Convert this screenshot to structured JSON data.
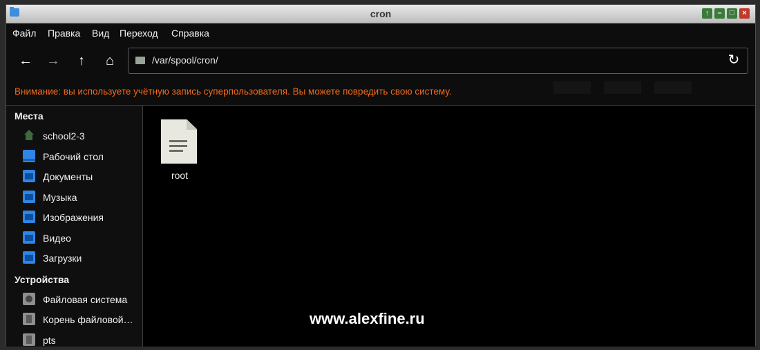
{
  "window": {
    "title": "cron"
  },
  "menu": [
    "Файл",
    "Правка",
    "Вид",
    "Переход",
    "Справка"
  ],
  "toolbar": {
    "path": "/var/spool/cron/"
  },
  "warning": "Внимание: вы используете учётную запись суперпользователя. Вы можете повредить свою систему.",
  "sidebar": {
    "places_title": "Места",
    "places": [
      {
        "label": "school2-3",
        "icon": "home-icon"
      },
      {
        "label": "Рабочий стол",
        "icon": "desktop-folder-icon"
      },
      {
        "label": "Документы",
        "icon": "documents-folder-icon"
      },
      {
        "label": "Музыка",
        "icon": "music-folder-icon"
      },
      {
        "label": "Изображения",
        "icon": "pictures-folder-icon"
      },
      {
        "label": "Видео",
        "icon": "videos-folder-icon"
      },
      {
        "label": "Загрузки",
        "icon": "downloads-folder-icon"
      }
    ],
    "devices_title": "Устройства",
    "devices": [
      {
        "label": "Файловая система",
        "icon": "filesystem-icon"
      },
      {
        "label": "Корень файловой…",
        "icon": "drive-icon"
      },
      {
        "label": "pts",
        "icon": "drive-icon"
      }
    ]
  },
  "files": [
    {
      "name": "root",
      "icon": "text-file-icon"
    }
  ],
  "watermark": "www.alexfine.ru"
}
